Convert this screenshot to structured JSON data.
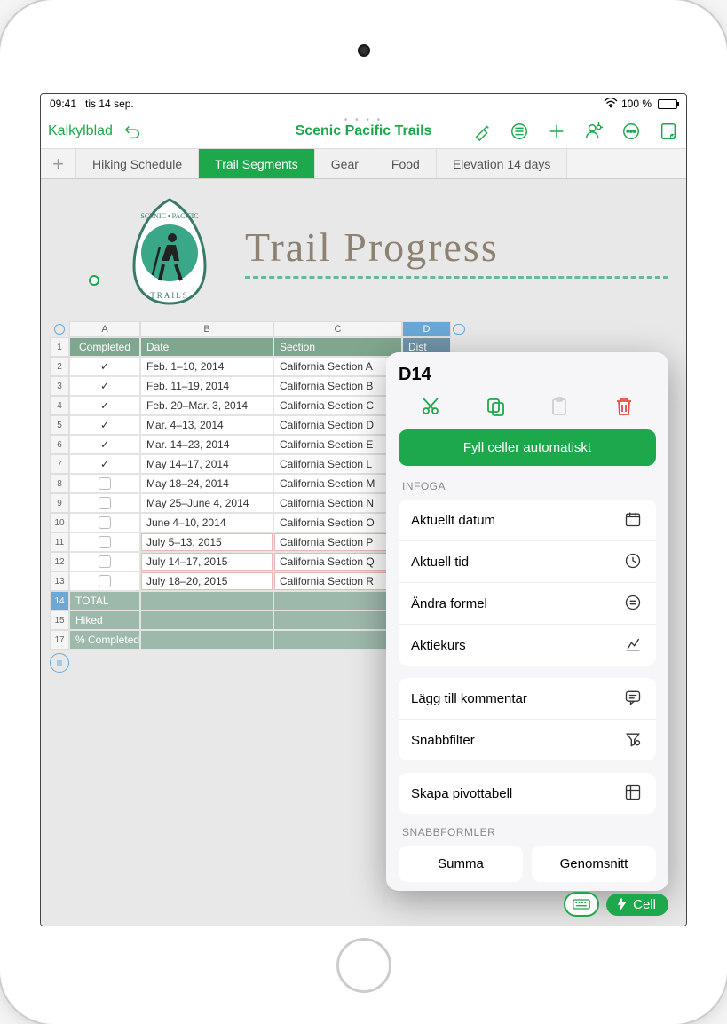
{
  "statusbar": {
    "time": "09:41",
    "date": "tis 14 sep.",
    "battery": "100 %"
  },
  "toolbar": {
    "back_label": "Kalkylblad",
    "doc_title": "Scenic Pacific Trails"
  },
  "tabs": [
    {
      "label": "Hiking Schedule",
      "active": false
    },
    {
      "label": "Trail Segments",
      "active": true
    },
    {
      "label": "Gear",
      "active": false
    },
    {
      "label": "Food",
      "active": false
    },
    {
      "label": "Elevation 14 days",
      "active": false
    }
  ],
  "page_title": "Trail Progress",
  "columns": {
    "A": "A",
    "B": "B",
    "C": "C",
    "D": "D"
  },
  "headers": {
    "completed": "Completed",
    "date": "Date",
    "section": "Section",
    "distance": "Dist"
  },
  "rows": [
    {
      "n": 2,
      "done": true,
      "date": "Feb. 1–10, 2014",
      "section": "California Section A"
    },
    {
      "n": 3,
      "done": true,
      "date": "Feb. 11–19, 2014",
      "section": "California Section B"
    },
    {
      "n": 4,
      "done": true,
      "date": "Feb. 20–Mar. 3, 2014",
      "section": "California Section C"
    },
    {
      "n": 5,
      "done": true,
      "date": "Mar. 4–13, 2014",
      "section": "California Section D"
    },
    {
      "n": 6,
      "done": true,
      "date": "Mar. 14–23, 2014",
      "section": "California Section E"
    },
    {
      "n": 7,
      "done": true,
      "date": "May 14–17, 2014",
      "section": "California Section L"
    },
    {
      "n": 8,
      "done": false,
      "date": "May 18–24, 2014",
      "section": "California Section M"
    },
    {
      "n": 9,
      "done": false,
      "date": "May 25–June 4, 2014",
      "section": "California Section N"
    },
    {
      "n": 10,
      "done": false,
      "date": "June 4–10, 2014",
      "section": "California Section O"
    },
    {
      "n": 11,
      "done": false,
      "date": "July 5–13, 2015",
      "section": "California Section P",
      "red": true
    },
    {
      "n": 12,
      "done": false,
      "date": "July 14–17, 2015",
      "section": "California Section Q",
      "red": true
    },
    {
      "n": 13,
      "done": false,
      "date": "July 18–20, 2015",
      "section": "California Section R",
      "red": true
    }
  ],
  "summary": {
    "r14": "TOTAL",
    "r15": "Hiked",
    "r17": "% Completed"
  },
  "popover": {
    "cell_ref": "D14",
    "autofill": "Fyll celler automatiskt",
    "section_insert": "INFOGA",
    "items_insert": [
      {
        "label": "Aktuellt datum",
        "icon": "calendar"
      },
      {
        "label": "Aktuell tid",
        "icon": "clock"
      },
      {
        "label": "Ändra formel",
        "icon": "equals"
      },
      {
        "label": "Aktiekurs",
        "icon": "chart"
      }
    ],
    "items_mid": [
      {
        "label": "Lägg till kommentar",
        "icon": "comment"
      },
      {
        "label": "Snabbfilter",
        "icon": "filter"
      }
    ],
    "items_pivot": [
      {
        "label": "Skapa pivottabell",
        "icon": "pivot"
      }
    ],
    "section_quick": "SNABBFORMLER",
    "quick": {
      "sum": "Summa",
      "avg": "Genomsnitt"
    }
  },
  "bottom_pill": {
    "cell": "Cell"
  }
}
